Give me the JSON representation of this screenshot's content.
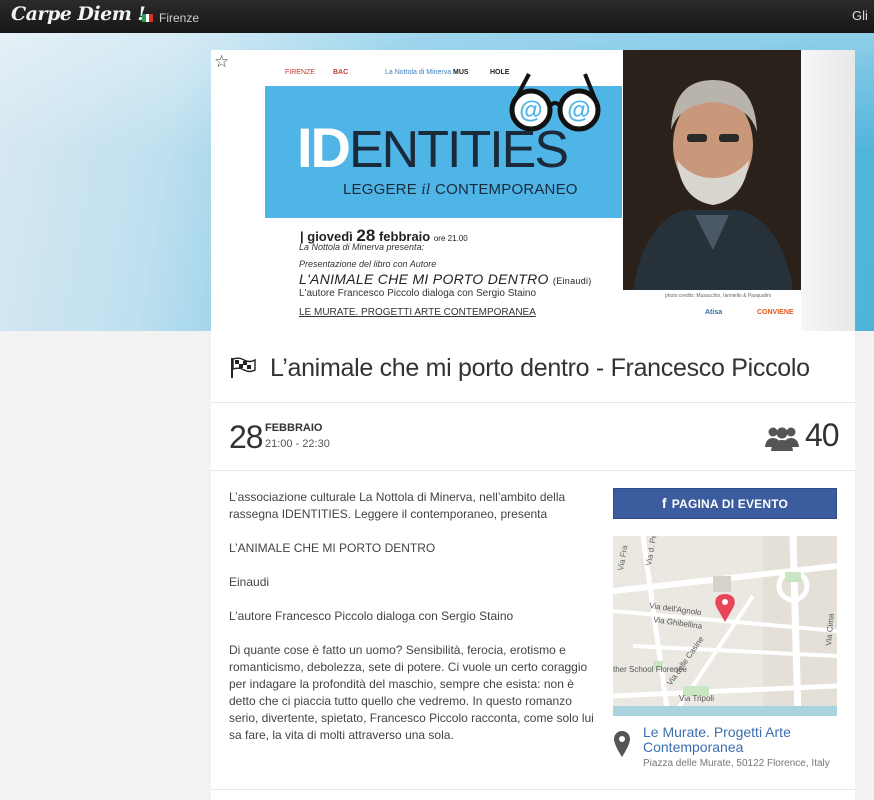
{
  "topbar": {
    "logo": "Carpe Diem !",
    "city": "Firenze",
    "right_link": "Gli"
  },
  "poster": {
    "sponsors": [
      "FIRENZE",
      "BAC",
      "La Nottola di Minerva",
      "MUS",
      "HOLE"
    ],
    "title_id": "ID",
    "title_rest": "ENTITIES",
    "subtitle_pre": "LEGGERE",
    "subtitle_mid": "il",
    "subtitle_post": "CONTEMPORANEO",
    "glasses_text": "@@",
    "date_pre": "| giovedì",
    "date_day": "28",
    "date_month": "febbraio",
    "date_time": "ore 21.00",
    "line1": "La Nottola di Minerva presenta:",
    "line2": "Presentazione del libro con Autore",
    "book": "L'ANIMALE CHE MI PORTO DENTRO",
    "publisher": "(Einaudi)",
    "author_line": "L'autore Francesco Piccolo dialoga con Sergio Staino",
    "venue": "LE MURATE. PROGETTI ARTE CONTEMPORANEA",
    "photo_credit": "photo credits: Musacchio, Ianniello & Pasqualini",
    "logo_left": "Atisa",
    "logo_right": "CONVIENE"
  },
  "event": {
    "title": "L’animale che mi porto dentro - Francesco Piccolo",
    "day": "28",
    "month": "FEBBRAIO",
    "time": "21:00 - 22:30",
    "attendees": "40"
  },
  "description": [
    "L’associazione culturale La Nottola di Minerva, nell’ambito della rassegna IDENTITIES. Leggere il contemporaneo, presenta",
    "L’ANIMALE CHE MI PORTO DENTRO",
    "Einaudi",
    "L’autore Francesco Piccolo dialoga con Sergio Staino",
    "Di quante cose è fatto un uomo? Sensibilità, ferocia, erotismo e romanticismo, debolezza, sete di potere. Ci vuole un certo coraggio per indagare la profondità del maschio, sempre che esista: non è detto che ci piaccia tutto quello che vedremo. In questo romanzo serio, divertente, spietato, Francesco Piccolo racconta, come solo lui sa fare, la vita di molti attraverso una sola."
  ],
  "sidebar": {
    "fb_icon": "f",
    "fb_button": "PAGINA DI EVENTO",
    "map_labels": {
      "via_pergola": "Via d. Pergola",
      "via_agnolo": "Via dell'Agnolo",
      "via_ghibellina": "Via Ghibellina",
      "via_casine": "Via delle Casine",
      "via_tripoli": "Via Tripoli",
      "school": "ther School Florence",
      "via_fra": "Via Fra",
      "via_cima": "Via Cima"
    },
    "venue_name": "Le Murate. Progetti Arte Contemporanea",
    "venue_address": "Piazza delle Murate, 50122 Florence, Italy"
  },
  "colors": {
    "facebook": "#3b5c9e",
    "venue_link": "#3a6fb0",
    "poster_blue": "#4fb4e6",
    "map_pin": "#e8445a"
  }
}
